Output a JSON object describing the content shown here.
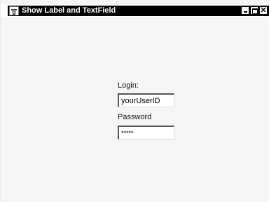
{
  "window": {
    "title": "Show Label and TextField",
    "icon": "java-cup-icon",
    "controls": {
      "minimize_icon": "minimize-icon",
      "maximize_icon": "maximize-icon",
      "close_icon": "close-icon",
      "close_glyph": "✕"
    }
  },
  "form": {
    "login_label": "Login:",
    "login_value": "yourUserID",
    "password_label": "Password",
    "password_value": "*****"
  },
  "colors": {
    "titlebar": "#000000",
    "titlebar_text": "#ffffff",
    "background": "#f5f5f5"
  }
}
